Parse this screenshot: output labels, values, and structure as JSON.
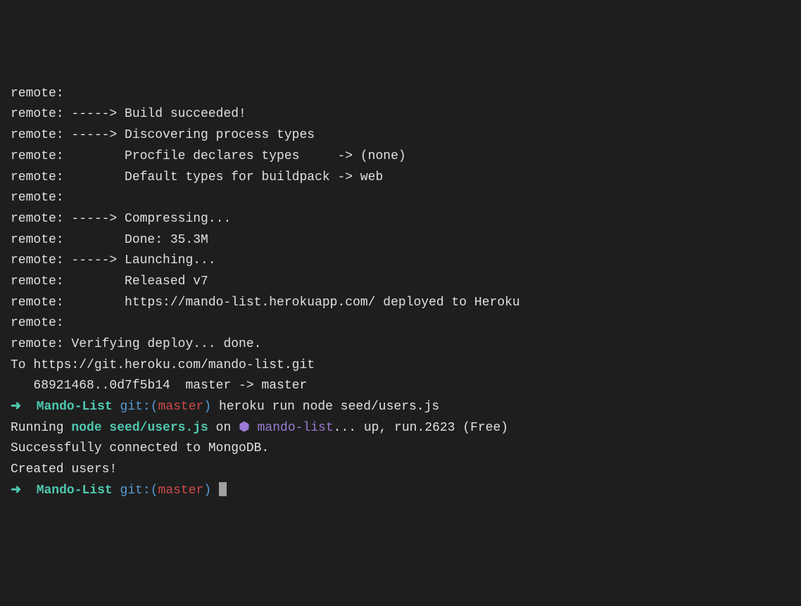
{
  "lines": {
    "l0": "remote:        ",
    "l1": "remote: -----> Build succeeded!",
    "l2": "remote: -----> Discovering process types",
    "l3": "remote:        Procfile declares types     -> (none)",
    "l4": "remote:        Default types for buildpack -> web",
    "l5": "remote: ",
    "l6": "remote: -----> Compressing...",
    "l7": "remote:        Done: 35.3M",
    "l8": "remote: -----> Launching...",
    "l9": "remote:        Released v7",
    "l10": "remote:        https://mando-list.herokuapp.com/ deployed to Heroku",
    "l11": "remote: ",
    "l12": "remote: Verifying deploy... done.",
    "l13": "To https://git.heroku.com/mando-list.git",
    "l14": "   68921468..0d7f5b14  master -> master"
  },
  "prompt1": {
    "arrow": "➜  ",
    "project": "Mando-List",
    "git_prefix": " git:(",
    "branch": "master",
    "git_suffix": ")",
    "command": " heroku run node seed/users.js"
  },
  "running": {
    "prefix": "Running ",
    "cmd": "node seed/users.js",
    "on": " on ",
    "hex": "⬢ ",
    "app": "mando-list",
    "suffix": "... up, run.2623 (Free)"
  },
  "output": {
    "l1": "Successfully connected to MongoDB.",
    "l2": "Created users!"
  },
  "prompt2": {
    "arrow": "➜  ",
    "project": "Mando-List",
    "git_prefix": " git:(",
    "branch": "master",
    "git_suffix": ") "
  }
}
